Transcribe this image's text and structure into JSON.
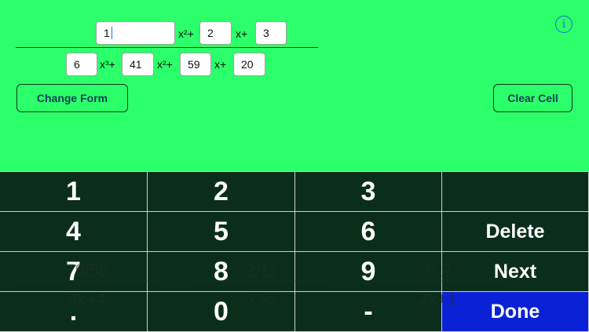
{
  "equation": {
    "numerator": {
      "c2": "1",
      "t2": "x²+",
      "c1": "2",
      "t1": "x+",
      "c0": "3"
    },
    "denominator": {
      "c3": "6",
      "t3": "x³+",
      "c2": "41",
      "t2": "x²+",
      "c1": "59",
      "t1": "x+",
      "c0": "20"
    }
  },
  "buttons": {
    "change_form": "Change Form",
    "clear_cell": "Clear Cell",
    "info": "i"
  },
  "keypad": {
    "k1": "1",
    "k2": "2",
    "k3": "3",
    "k4": "4",
    "k5": "5",
    "k6": "6",
    "delete": "Delete",
    "k7": "7",
    "k8": "8",
    "k9": "9",
    "next": "Next",
    "dot": ".",
    "k0": "0",
    "minus": "-",
    "done": "Done"
  },
  "partial_fractions": [
    {
      "num": "-79/55",
      "den": "3x+4"
    },
    {
      "num": "2/11",
      "den": "x+5"
    },
    {
      "num": "0.2",
      "den": "2x+1"
    }
  ],
  "partial_plus": "+",
  "colors": {
    "background": "#2bff6a",
    "keypad": "#0b2e1c",
    "done": "#0a21d6",
    "accent": "#1f6fd6"
  }
}
